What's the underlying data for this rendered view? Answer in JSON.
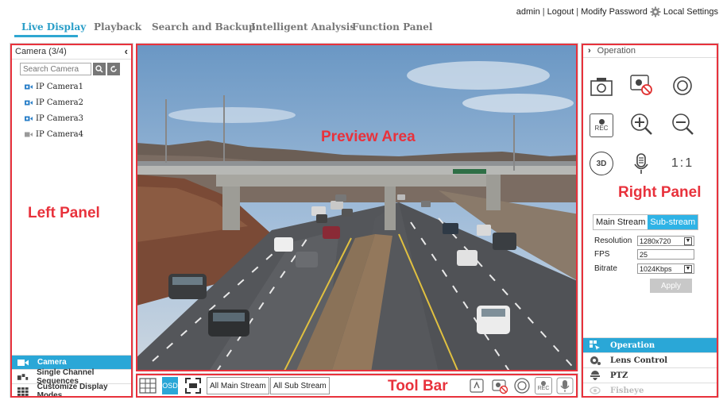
{
  "nav": {
    "tabs": [
      {
        "label": "Live Display",
        "active": true
      },
      {
        "label": "Playback",
        "active": false
      },
      {
        "label": "Search and Backup",
        "active": false
      },
      {
        "label": "Intelligent Analysis",
        "active": false
      },
      {
        "label": "Function Panel",
        "active": false
      }
    ],
    "user": "admin",
    "logout": "Logout",
    "modify_password": "Modify Password",
    "local_settings": "Local Settings"
  },
  "left_panel": {
    "header": "Camera (3/4)",
    "search_placeholder": "Search Camera",
    "cameras": [
      {
        "name": "IP Camera1",
        "online": true
      },
      {
        "name": "IP Camera2",
        "online": true
      },
      {
        "name": "IP Camera3",
        "online": true
      },
      {
        "name": "IP Camera4",
        "online": false
      }
    ],
    "bottom_items": [
      {
        "label": "Camera",
        "active": true
      },
      {
        "label": "Single Channel Sequences",
        "active": false
      },
      {
        "label": "Customize Display Modes",
        "active": false
      }
    ]
  },
  "labels": {
    "left_panel": "Left Panel",
    "preview_area": "Preview Area",
    "right_panel": "Right Panel",
    "tool_bar": "Tool Bar"
  },
  "right_panel": {
    "header": "Operation",
    "stream_tabs": [
      "Main Stream",
      "Sub-stream"
    ],
    "resolution_label": "Resolution",
    "resolution_value": "1280x720",
    "fps_label": "FPS",
    "fps_value": "25",
    "bitrate_label": "Bitrate",
    "bitrate_value": "1024Kbps",
    "apply": "Apply",
    "rec_icon_text": "REC",
    "three_d_text": "3D",
    "one_to_one_text": "1:1",
    "bottom_items": [
      {
        "label": "Operation",
        "active": true
      },
      {
        "label": "Lens Control",
        "active": false
      },
      {
        "label": "PTZ",
        "active": false
      },
      {
        "label": "Fisheye",
        "active": false,
        "disabled": true
      }
    ]
  },
  "toolbar": {
    "osd": "OSD",
    "all_main_stream": "All Main Stream",
    "all_sub_stream": "All Sub Stream",
    "rec_text": "REC"
  },
  "colors": {
    "accent": "#2aa7d7",
    "outline": "#e8323c"
  }
}
